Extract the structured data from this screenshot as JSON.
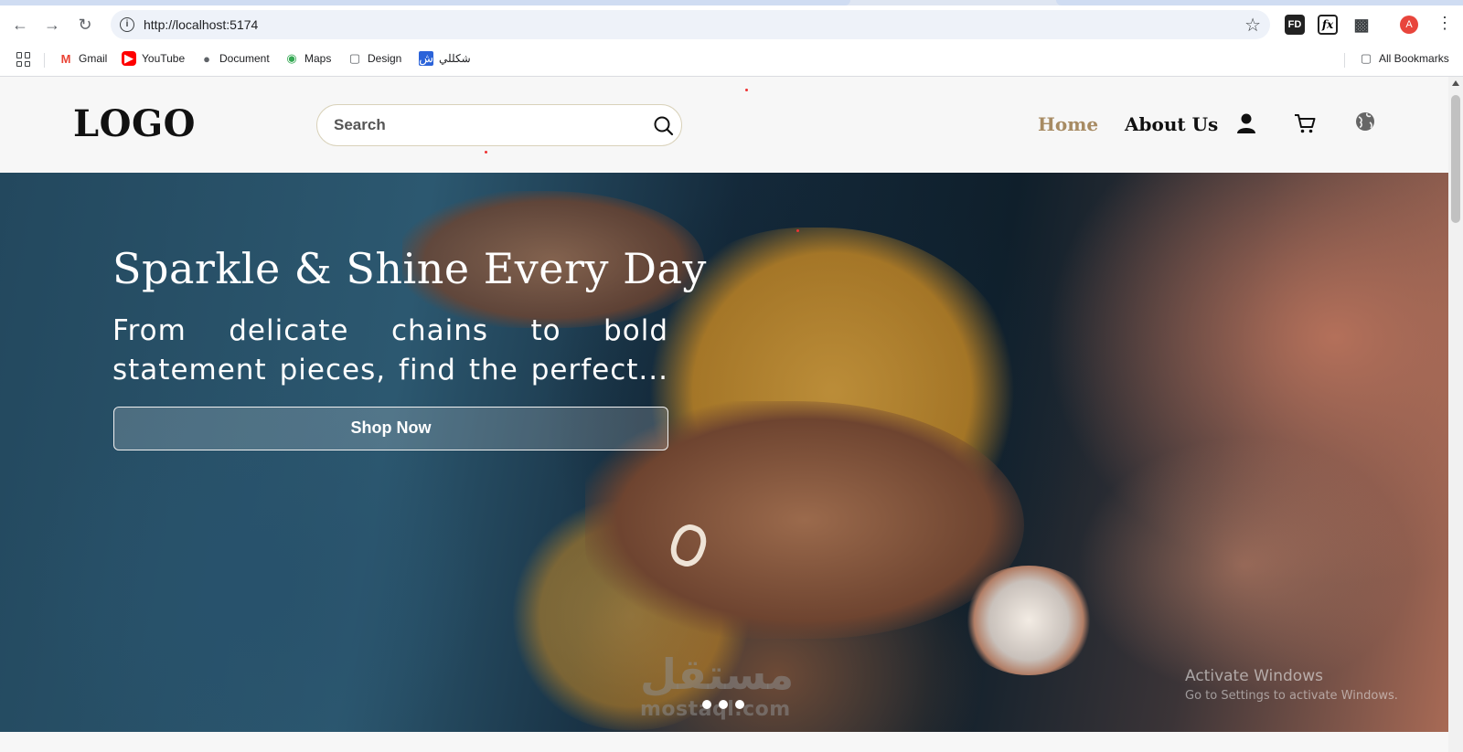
{
  "browser": {
    "url": "http://localhost:5174",
    "bookmarks": [
      {
        "label": "Gmail",
        "icon": "gmail-icon"
      },
      {
        "label": "YouTube",
        "icon": "youtube-icon"
      },
      {
        "label": "Document",
        "icon": "globe-icon"
      },
      {
        "label": "Maps",
        "icon": "maps-pin-icon"
      },
      {
        "label": "Design",
        "icon": "folder-icon"
      },
      {
        "label": "شكللي",
        "icon": "shakkelli-icon"
      }
    ],
    "all_bookmarks": "All Bookmarks",
    "profile_initial": "A",
    "ext_fd": "FD",
    "ext_fx": "fx"
  },
  "site": {
    "logo": "LOGO",
    "search_placeholder": "Search",
    "nav": {
      "home": "Home",
      "about": "About Us"
    },
    "accent_color": "#a78b63"
  },
  "hero": {
    "title": "Sparkle & Shine Every Day",
    "subtitle": "From delicate chains to bold statement pieces, find the perfect...",
    "cta": "Shop Now",
    "slide_count": 3
  },
  "overlays": {
    "watermark_arabic": "مستقل",
    "watermark_latin": "mostaql.com",
    "activate_windows": "Activate Windows",
    "activate_windows_hint": "Go to Settings to activate Windows."
  }
}
